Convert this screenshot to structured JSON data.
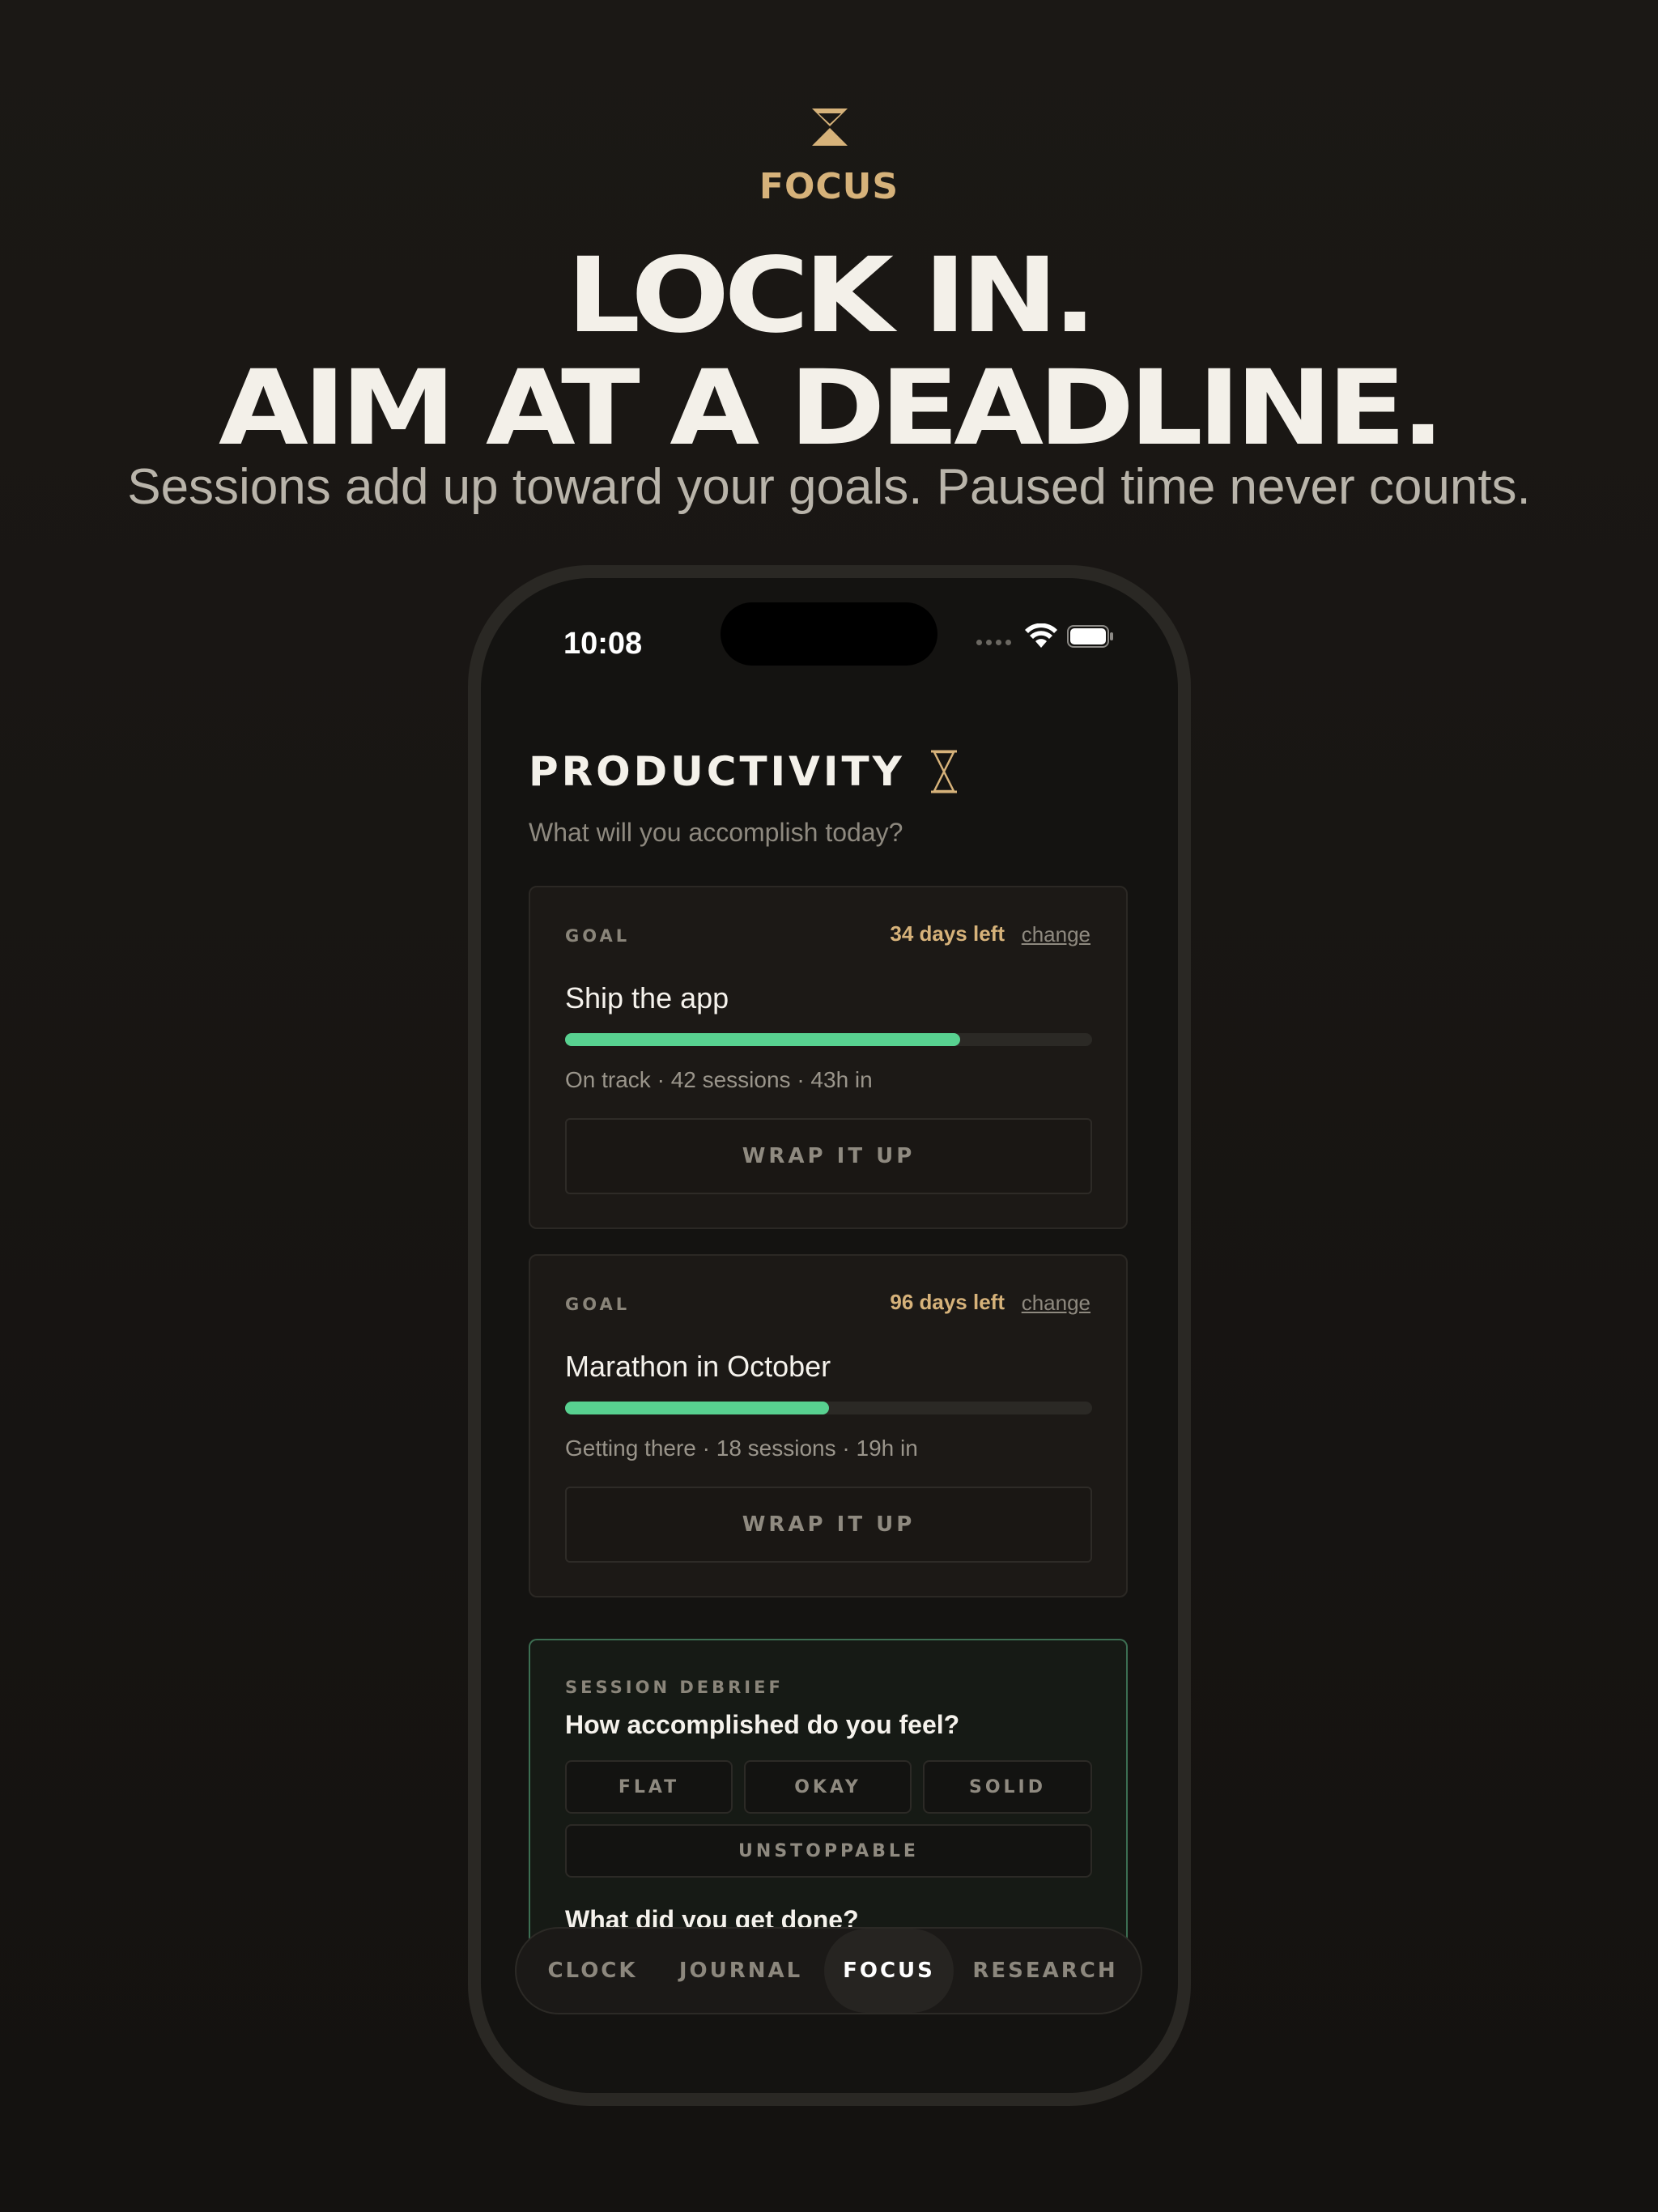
{
  "brand": {
    "name": "FOCUS",
    "icon": "hourglass-icon"
  },
  "hero": {
    "line1": "LOCK IN.",
    "line2": "AIM AT A DEADLINE.",
    "subline": "Sessions add up toward your goals. Paused time never counts."
  },
  "status_bar": {
    "time": "10:08"
  },
  "page": {
    "title": "PRODUCTIVITY",
    "subtitle": "What will you accomplish today?"
  },
  "goals": [
    {
      "label": "GOAL",
      "days_left": "34 days left",
      "change": "change",
      "name": "Ship the app",
      "progress": 0.75,
      "meta": "On track · 42 sessions · 43h in",
      "action": "WRAP IT UP"
    },
    {
      "label": "GOAL",
      "days_left": "96 days left",
      "change": "change",
      "name": "Marathon in October",
      "progress": 0.5,
      "meta": "Getting there · 18 sessions · 19h in",
      "action": "WRAP IT UP"
    }
  ],
  "debrief": {
    "label": "SESSION DEBRIEF",
    "question1": "How accomplished do you feel?",
    "options": [
      "FLAT",
      "OKAY",
      "SOLID",
      "UNSTOPPABLE"
    ],
    "question2": "What did you get done?"
  },
  "tabs": [
    {
      "label": "CLOCK",
      "active": false
    },
    {
      "label": "JOURNAL",
      "active": false
    },
    {
      "label": "FOCUS",
      "active": true
    },
    {
      "label": "RESEARCH",
      "active": false
    }
  ],
  "colors": {
    "accent_gold": "#d6b27a",
    "progress_green": "#58d190",
    "debrief_border": "#3c6e52"
  }
}
